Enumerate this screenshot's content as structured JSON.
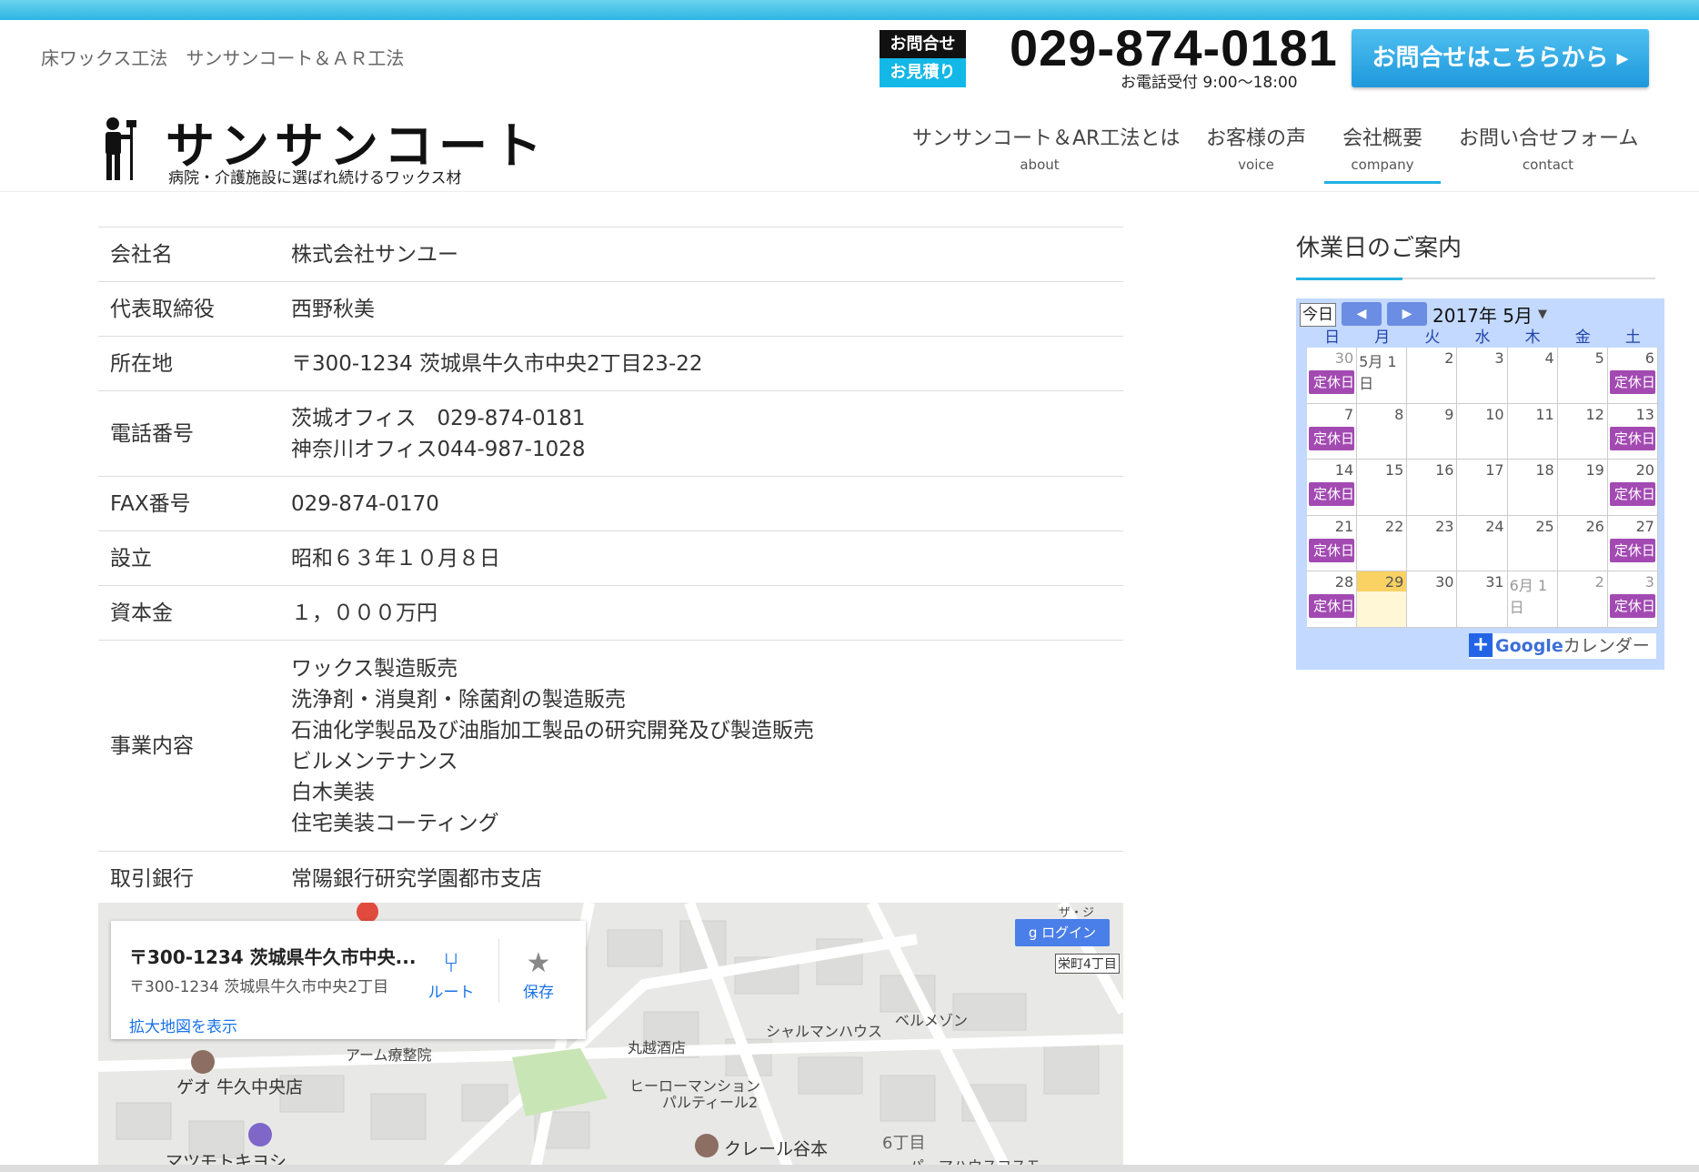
{
  "header": {
    "subtitle": "床ワックス工法　サンサンコート＆ＡＲ工法",
    "inquiry_label": "お問合せ",
    "estimate_label": "お見積り",
    "phone": "029-874-0181",
    "hours": "お電話受付 9:00〜18:00",
    "contact_button": "お問合せはこちらから ▸"
  },
  "logo": {
    "title": "サンサンコート",
    "tagline": "病院・介護施設に選ばれ続けるワックス材"
  },
  "nav": [
    {
      "jp": "サンサンコート＆AR工法とは",
      "en": "about"
    },
    {
      "jp": "お客様の声",
      "en": "voice"
    },
    {
      "jp": "会社概要",
      "en": "company"
    },
    {
      "jp": "お問い合せフォーム",
      "en": "contact"
    }
  ],
  "company": [
    {
      "key": "会社名",
      "lines": [
        "株式会社サンユー"
      ]
    },
    {
      "key": "代表取締役",
      "lines": [
        "西野秋美"
      ]
    },
    {
      "key": "所在地",
      "lines": [
        "〒300-1234 茨城県牛久市中央2丁目23-22"
      ]
    },
    {
      "key": "電話番号",
      "lines": [
        "茨城オフィス　029-874-0181",
        "神奈川オフィス044-987-1028"
      ]
    },
    {
      "key": "FAX番号",
      "lines": [
        "029-874-0170"
      ]
    },
    {
      "key": "設立",
      "lines": [
        "昭和６３年１０月８日"
      ]
    },
    {
      "key": "資本金",
      "lines": [
        "１，０００万円"
      ]
    },
    {
      "key": "事業内容",
      "lines": [
        "ワックス製造販売",
        "洗浄剤・消臭剤・除菌剤の製造販売",
        "石油化学製品及び油脂加工製品の研究開発及び製造販売",
        "ビルメンテナンス",
        "白木美装",
        "住宅美装コーティング"
      ]
    },
    {
      "key": "取引銀行",
      "lines": [
        "常陽銀行研究学園都市支店"
      ]
    }
  ],
  "map": {
    "title": "〒300-1234 茨城県牛久市中央...",
    "address": "〒300-1234 茨城県牛久市中央2丁目",
    "route": "ルート",
    "save": "保存",
    "enlarge": "拡大地図を表示",
    "login": "ログイン",
    "street": "栄町4丁目",
    "pois": [
      "アーム療整院",
      "ゲオ 牛久中央店",
      "マツモトキヨシ",
      "丸越酒店",
      "シャルマンハウス",
      "ベルメゾン",
      "ヒーローマンション",
      "パルティール2",
      "クレール谷本",
      "6丁目",
      "パーマハウスコスモ",
      "ザ・ジ"
    ]
  },
  "sidebar": {
    "title": "休業日のご案内",
    "calendar": {
      "today_btn": "今日",
      "month": "2017年 5月",
      "weekdays": [
        "日",
        "月",
        "火",
        "水",
        "木",
        "金",
        "土"
      ],
      "days": [
        "30",
        "5月 1日",
        "2",
        "3",
        "4",
        "5",
        "6",
        "7",
        "8",
        "9",
        "10",
        "11",
        "12",
        "13",
        "14",
        "15",
        "16",
        "17",
        "18",
        "19",
        "20",
        "21",
        "22",
        "23",
        "24",
        "25",
        "26",
        "27",
        "28",
        "29",
        "30",
        "31",
        "6月 1日",
        "2",
        "3"
      ],
      "event_label": "定休日",
      "today_day": "29",
      "footer": "カレンダー",
      "google": "Google"
    }
  },
  "colors": {
    "accent": "#1fb1e2",
    "event": "#a24ab2",
    "calendar_bg": "#c3d9ff"
  }
}
